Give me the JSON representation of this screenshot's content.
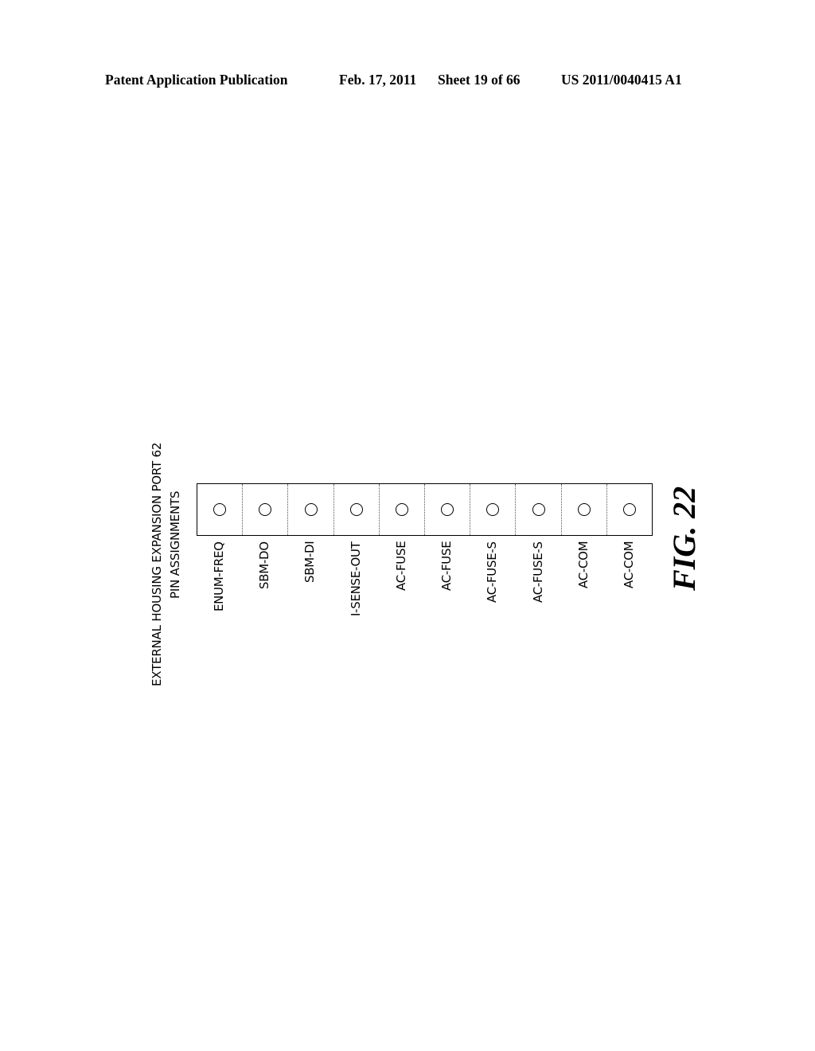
{
  "header": {
    "publication": "Patent Application Publication",
    "date": "Feb. 17, 2011",
    "sheet": "Sheet 19 of 66",
    "number": "US 2011/0040415 A1"
  },
  "diagram": {
    "title_line1": "EXTERNAL HOUSING EXPANSION PORT 62",
    "title_line2": "PIN ASSIGNMENTS",
    "pins": [
      {
        "label": "ENUM-FREQ"
      },
      {
        "label": "SBM-DO"
      },
      {
        "label": "SBM-DI"
      },
      {
        "label": "I-SENSE-OUT"
      },
      {
        "label": "AC-FUSE"
      },
      {
        "label": "AC-FUSE"
      },
      {
        "label": "AC-FUSE-S"
      },
      {
        "label": "AC-FUSE-S"
      },
      {
        "label": "AC-COM"
      },
      {
        "label": "AC-COM"
      }
    ],
    "figure_label": "FIG. 22"
  }
}
